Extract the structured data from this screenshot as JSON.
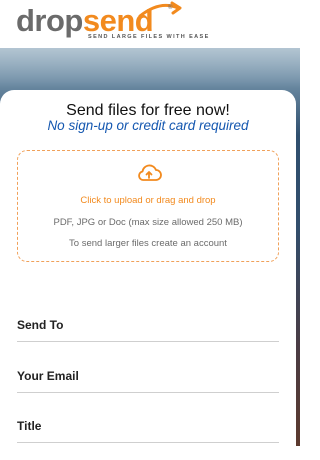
{
  "logo": {
    "word_part1": "drop",
    "word_part2": "send",
    "registered": "®",
    "tagline": "SEND LARGE FILES WITH EASE",
    "colors": {
      "gray": "#6b6b6b",
      "orange": "#f28a1e"
    }
  },
  "card": {
    "title": "Send files for free now!",
    "subtitle": "No sign-up or credit card required"
  },
  "dropzone": {
    "icon": "cloud-upload-icon",
    "upload_link": "Click to upload",
    "upload_rest": " or drag and drop",
    "formats": "PDF, JPG or Doc (max size allowed 250 MB)",
    "larger_files": "To send larger files create an account",
    "accent_color": "#f28a1e"
  },
  "form": {
    "send_to_label": "Send To",
    "email_label": "Your Email",
    "title_label": "Title"
  }
}
